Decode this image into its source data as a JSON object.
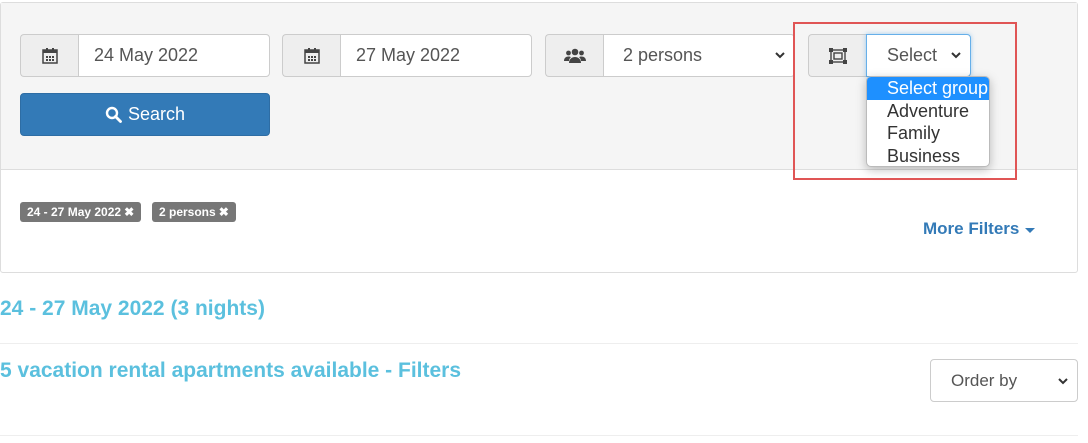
{
  "search_form": {
    "checkin": {
      "value": "24 May 2022",
      "icon": "calendar-icon"
    },
    "checkout": {
      "value": "27 May 2022",
      "icon": "calendar-icon"
    },
    "guests": {
      "value": "2 persons",
      "icon": "users-icon"
    },
    "group": {
      "value": "Select",
      "icon": "group-frame-icon",
      "options": [
        "Select group",
        "Adventure",
        "Family",
        "Business"
      ],
      "selected_index": 0
    },
    "search_button": "Search"
  },
  "active_filters": {
    "badges": [
      "24 - 27 May 2022",
      "2 persons"
    ],
    "more_filters": "More Filters"
  },
  "results": {
    "dates_heading": "24 - 27 May 2022 (3 nights)",
    "count_heading": "5 vacation rental apartments available - Filters",
    "order_by": "Order by"
  },
  "colors": {
    "primary": "#337ab7",
    "heading": "#5bc0de",
    "badge": "#777777",
    "highlight": "#e05555",
    "option_selected": "#1e90ff"
  }
}
